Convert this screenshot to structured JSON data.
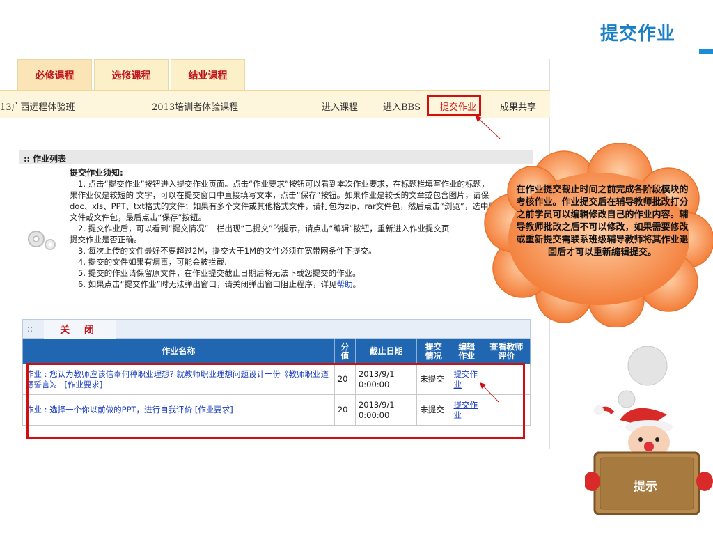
{
  "slide": {
    "title": "提交作业"
  },
  "tabs": [
    {
      "label": "必修课程",
      "active": true
    },
    {
      "label": "选修课程",
      "active": false
    },
    {
      "label": "结业课程",
      "active": false
    }
  ],
  "course": {
    "class_name": "13广西远程体验班",
    "course_name": "2013培训者体验课程",
    "links": [
      "进入课程",
      "进入BBS",
      "提交作业",
      "成果共享"
    ]
  },
  "list": {
    "title": ":: 作业列表",
    "notice_title": "提交作业须知:",
    "notice_lines": [
      "1. 点击“提交作业”按钮进入提交作业页面。点击“作业要求”按钮可以看到本次作业要求，在标题栏填写作业的标题，",
      "果作业仅是较短的 文字，可以在提交窗口中直接填写文本，点击“保存”按钮。如果作业是较长的文章或包含图片，请保",
      "doc、xls、PPT、txt格式的文件；如果有多个文件或其他格式文件，请打包为zip、rar文件包，然后点击“浏览”，选中要",
      "文件或文件包，最后点击“保存”按钮。",
      "2. 提交作业后，可以看到“提交情况”一栏出现“已提交”的提示，请点击“编辑”按钮，重新进入作业提交页",
      "提交作业是否正确。",
      "3. 每次上传的文件最好不要超过2M，提交大于1M的文件必须在宽带网条件下提交。",
      "4. 提交的文件如果有病毒，可能会被拦截.",
      "5. 提交的作业请保留原文件，在作业提交截止日期后将无法下载您提交的作业。",
      "6. 如果点击“提交作业”时无法弹出窗口，请关闭弹出窗口阻止程序，详见"
    ],
    "help_link": "帮助",
    "help_suffix": "。"
  },
  "closebar": {
    "dots": "::",
    "close_label": "关 闭"
  },
  "table": {
    "headers": [
      "作业名称",
      "分值",
      "截止日期",
      "提交情况",
      "编辑作业",
      "查看教师评价"
    ],
    "rows": [
      {
        "name": "作业 :  您认为教师应该信奉何种职业理想? 就教师职业理想问题设计一份《教师职业道德誓言》。 [作业要求]",
        "score": "20",
        "deadline": "2013/9/1 0:00:00",
        "status": "未提交",
        "edit": "提交作业",
        "review": ""
      },
      {
        "name": "作业 :  选择一个你以前做的PPT，进行自我评价 [作业要求]",
        "score": "20",
        "deadline": "2013/9/1 0:00:00",
        "status": "未提交",
        "edit": "提交作业",
        "review": ""
      }
    ]
  },
  "callout": {
    "text": "在作业提交截止时间之前完成各阶段模块的考核作业。作业提交后在辅导教师批改打分之前学员可以编辑修改自己的作业内容。辅导教师批改之后不可以修改，如果需要修改或重新提交需联系班级辅导教师将其作业退回后才可以重新编辑提交。"
  },
  "hint": {
    "label": "提示"
  },
  "colors": {
    "accent": "#1a7fc4",
    "tab_red": "#c0151d",
    "highlight": "#d01010",
    "header_blue": "#2066b0",
    "cloud": "#f58a4a"
  }
}
